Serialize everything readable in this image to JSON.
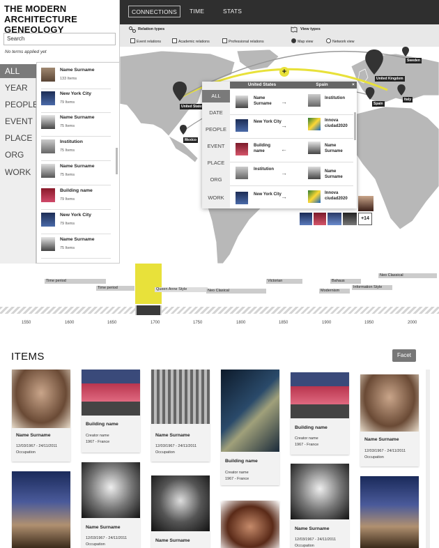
{
  "app_title": "THE MODERN ARCHITECTURE GENEOLOGY",
  "search": {
    "placeholder": "Search"
  },
  "no_terms": "No terms applied yet",
  "filter_menu": [
    "ALL",
    "YEAR",
    "PEOPLE",
    "EVENT",
    "PLACE",
    "ORG",
    "WORK"
  ],
  "item_list": [
    {
      "name": "Name Surname",
      "count": "133 Items",
      "icon": "person-photo"
    },
    {
      "name": "New York City",
      "count": "79 Items",
      "icon": "city-photo"
    },
    {
      "name": "Name Surname",
      "count": "75 Items",
      "icon": "person-photo"
    },
    {
      "name": "Institution",
      "count": "75 Items",
      "icon": "institution-photo"
    },
    {
      "name": "Name Surname",
      "count": "75 Items",
      "icon": "person-photo"
    },
    {
      "name": "Building name",
      "count": "79 Items",
      "icon": "building-photo"
    },
    {
      "name": "New York City",
      "count": "79 Items",
      "icon": "city-photo"
    },
    {
      "name": "Name Surname",
      "count": "75 Items",
      "icon": "person-photo"
    }
  ],
  "top_tabs": [
    "CONNECTIONS",
    "TIME",
    "STATS"
  ],
  "relation_types": {
    "label": "Relation types",
    "options": [
      "Event relations",
      "Academic relations",
      "Professional relations"
    ]
  },
  "view_types": {
    "label": "View types",
    "options": [
      "Map view",
      "Network view"
    ],
    "selected": "Map view"
  },
  "map_pins": [
    "United States",
    "Mexico",
    "Sweden",
    "United Kingdom",
    "Spain",
    "Italy"
  ],
  "map_plus": "+",
  "popup": {
    "menu": [
      "ALL",
      "DATE",
      "PEOPLE",
      "EVENT",
      "PLACE",
      "ORG",
      "WORK"
    ],
    "headers": [
      "United States",
      "Spain"
    ],
    "close": "×",
    "rows": [
      {
        "left": "Name Surname",
        "arrow": "→",
        "right": "Institution"
      },
      {
        "left": "New York City",
        "arrow": "→",
        "right": "Innova ciudad2020"
      },
      {
        "left": "Building name",
        "arrow": "←",
        "right": "Name Surname"
      },
      {
        "left": "Institution",
        "arrow": "→",
        "right": "Name Surname"
      },
      {
        "left": "New York City",
        "arrow": "→",
        "right": "Innova ciudad2020"
      }
    ]
  },
  "photo_more": "+14",
  "time_periods": [
    "Time period",
    "Time period",
    "Queen Anne Style",
    "Neo Clasical",
    "Victorian",
    "Bahaus",
    "Modernism",
    "Information Style",
    "Neo Classical"
  ],
  "years": [
    "1550",
    "1600",
    "1650",
    "1700",
    "1750",
    "1800",
    "1850",
    "1900",
    "1950",
    "2000"
  ],
  "items_title": "ITEMS",
  "facet_label": "Facet",
  "cards": [
    {
      "title": "Name Surname",
      "line1": "12/03/1967 - 24/11/2011",
      "line2": "Occupation"
    },
    {
      "title": "Building name",
      "line1": "Creator name",
      "line2": "1967 - France"
    },
    {
      "title": "Name Surname",
      "line1": "12/03/1967 - 24/11/2011",
      "line2": "Occupation"
    },
    {
      "title": "Building name",
      "line1": "Creator name",
      "line2": "1967 - France"
    },
    {
      "title": "Building name",
      "line1": "Creator name",
      "line2": "1967 - France"
    },
    {
      "title": "Name Surname",
      "line1": "12/03/1967 - 24/11/2011",
      "line2": "Occupation"
    },
    {
      "title": "",
      "line1": "",
      "line2": ""
    },
    {
      "title": "Name Surname",
      "line1": "12/03/1967 - 24/11/2011",
      "line2": "Occupation"
    },
    {
      "title": "Name Surname",
      "line1": "",
      "line2": ""
    },
    {
      "title": "",
      "line1": "",
      "line2": ""
    },
    {
      "title": "Name Surname",
      "line1": "12/03/1967 - 24/11/2011",
      "line2": "Occupation"
    },
    {
      "title": "",
      "line1": "",
      "line2": ""
    }
  ],
  "colors": {
    "accent_yellow": "#e8e13a",
    "dark_bar": "#2f2f2f",
    "map_land": "#b8b8b8"
  }
}
